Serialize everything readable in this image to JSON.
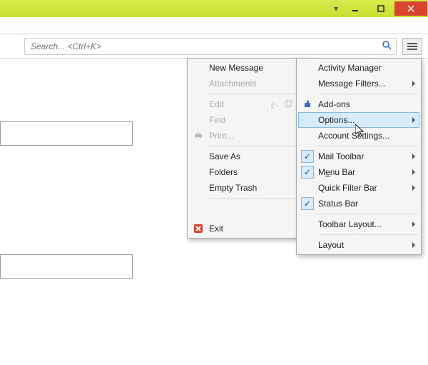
{
  "window": {
    "dropdown_glyph": "▾",
    "minimize_tip": "Minimize",
    "maximize_tip": "Maximize",
    "close_tip": "Close"
  },
  "search": {
    "placeholder": "Search... <Ctrl+K>"
  },
  "hamburger": {
    "tip": "Open menu"
  },
  "menu1": {
    "new_message": "New Message",
    "attachments": "Attachments",
    "edit": "Edit",
    "find": "Find",
    "print": "Print...",
    "save_as": "Save As",
    "folders": "Folders",
    "empty_trash": "Empty Trash",
    "exit": "Exit"
  },
  "menu2": {
    "activity_manager": "Activity Manager",
    "message_filters": "Message Filters...",
    "addons": "Add-ons",
    "options": "Options...",
    "account_settings": "Account Settings...",
    "mail_toolbar": "Mail Toolbar",
    "menu_bar_pre": "M",
    "menu_bar_u": "e",
    "menu_bar_post": "nu Bar",
    "quick_filter_bar": "Quick Filter Bar",
    "status_bar": "Status Bar",
    "toolbar_layout": "Toolbar Layout...",
    "layout": "Layout"
  }
}
